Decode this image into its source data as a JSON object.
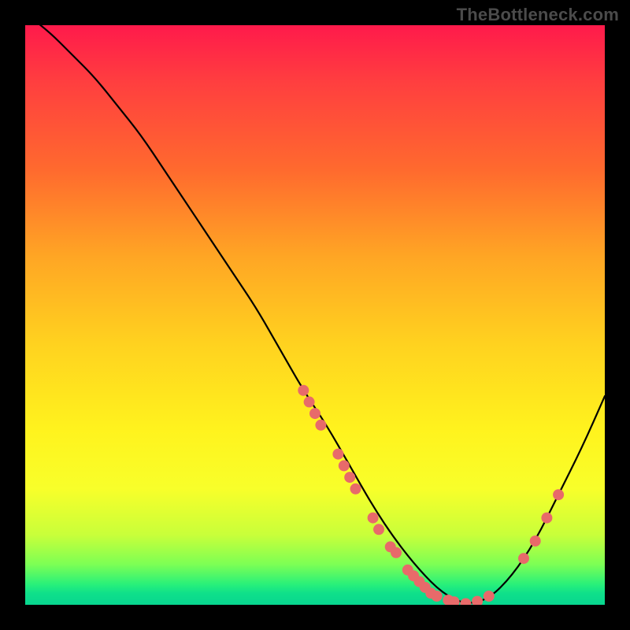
{
  "watermark": "TheBottleneck.com",
  "colors": {
    "background": "#000000",
    "dot": "#e86a6a",
    "curve": "#000000",
    "gradient_top": "#ff1a4b",
    "gradient_bottom": "#08d68f"
  },
  "chart_data": {
    "type": "line",
    "title": "",
    "xlabel": "",
    "ylabel": "",
    "xlim": [
      0,
      100
    ],
    "ylim": [
      0,
      100
    ],
    "series": [
      {
        "name": "bottleneck-curve",
        "x": [
          0,
          4,
          8,
          12,
          16,
          20,
          24,
          28,
          32,
          36,
          40,
          44,
          48,
          52,
          56,
          60,
          64,
          68,
          72,
          76,
          80,
          84,
          88,
          92,
          96,
          100
        ],
        "y": [
          102,
          99,
          95,
          91,
          86,
          81,
          75,
          69,
          63,
          57,
          51,
          44,
          37,
          31,
          24,
          17,
          11,
          6,
          2,
          0,
          1,
          5,
          11,
          19,
          27,
          36
        ]
      }
    ],
    "points": [
      {
        "x": 48,
        "y": 37
      },
      {
        "x": 49,
        "y": 35
      },
      {
        "x": 50,
        "y": 33
      },
      {
        "x": 51,
        "y": 31
      },
      {
        "x": 54,
        "y": 26
      },
      {
        "x": 55,
        "y": 24
      },
      {
        "x": 56,
        "y": 22
      },
      {
        "x": 57,
        "y": 20
      },
      {
        "x": 60,
        "y": 15
      },
      {
        "x": 61,
        "y": 13
      },
      {
        "x": 63,
        "y": 10
      },
      {
        "x": 64,
        "y": 9
      },
      {
        "x": 66,
        "y": 6
      },
      {
        "x": 67,
        "y": 5
      },
      {
        "x": 68,
        "y": 4
      },
      {
        "x": 69,
        "y": 3
      },
      {
        "x": 70,
        "y": 2
      },
      {
        "x": 71,
        "y": 1.5
      },
      {
        "x": 73,
        "y": 0.8
      },
      {
        "x": 74,
        "y": 0.5
      },
      {
        "x": 76,
        "y": 0.2
      },
      {
        "x": 78,
        "y": 0.6
      },
      {
        "x": 80,
        "y": 1.5
      },
      {
        "x": 86,
        "y": 8
      },
      {
        "x": 88,
        "y": 11
      },
      {
        "x": 90,
        "y": 15
      },
      {
        "x": 92,
        "y": 19
      }
    ]
  }
}
